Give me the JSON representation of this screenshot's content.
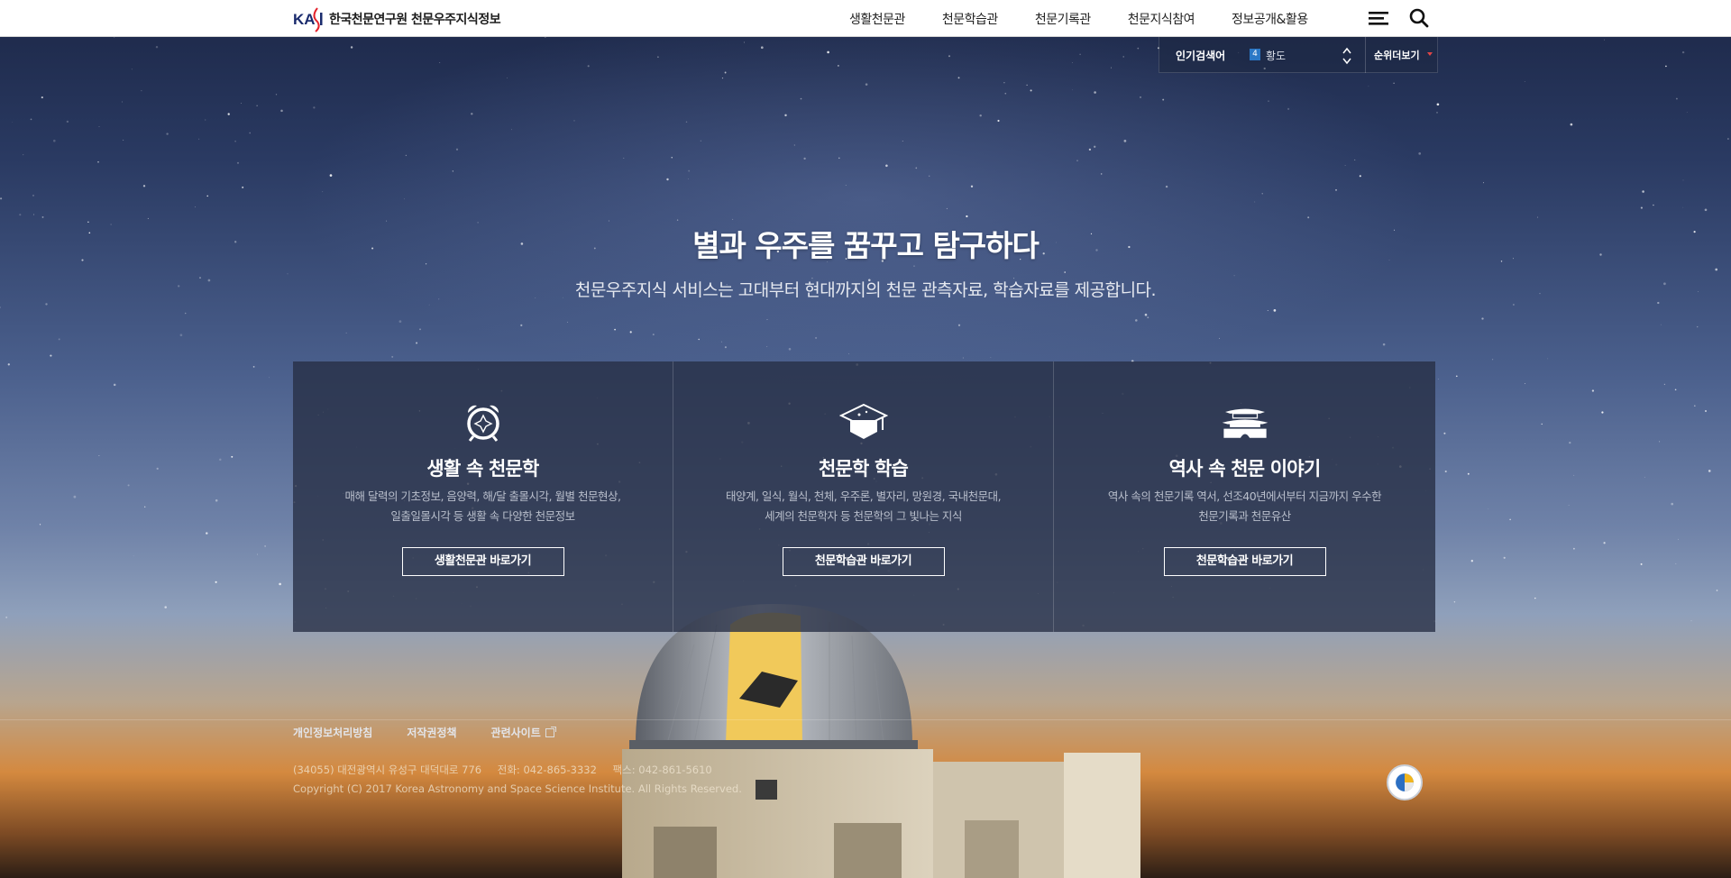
{
  "header": {
    "logo_mark": "KASI",
    "site_title": "한국천문연구원 천문우주지식정보",
    "nav": [
      "생활천문관",
      "천문학습관",
      "천문기록관",
      "천문지식참여",
      "정보공개&활용"
    ],
    "icons": {
      "menu": "hamburger-menu-icon",
      "search": "search-icon"
    }
  },
  "popular_search": {
    "label": "인기검색어",
    "rank": "4",
    "keyword": "황도",
    "more_label": "순위더보기"
  },
  "hero": {
    "title": "별과 우주를 꿈꾸고 탐구하다",
    "subtitle": "천문우주지식 서비스는 고대부터 현대까지의 천문 관측자료, 학습자료를 제공합니다."
  },
  "cards": [
    {
      "icon": "alarm-clock-icon",
      "title": "생활 속 천문학",
      "desc": [
        "매해 달력의 기초정보, 음양력, 해/달 출몰시각, 월별 천문현상,",
        "일출일몰시각 등 생활 속 다양한 천문정보"
      ],
      "button": "생활천문관 바로가기"
    },
    {
      "icon": "graduation-cap-icon",
      "title": "천문학 학습",
      "desc": [
        "태양계, 일식, 월식, 천체, 우주론, 별자리, 망원경, 국내천문대,",
        "세계의 천문학자 등 천문학의 그 빛나는 지식"
      ],
      "button": "천문학습관 바로가기"
    },
    {
      "icon": "palace-gate-icon",
      "title": "역사 속 천문 이야기",
      "desc": [
        "역사 속의 천문기록 역서, 선조40년에서부터 지금까지 우수한",
        "천문기록과 천문유산"
      ],
      "button": "천문학습관 바로가기"
    }
  ],
  "footer": {
    "links": [
      "개인정보처리방침",
      "저작권정책",
      "관련사이트"
    ],
    "address": "(34055) 대전광역시 유성구 대덕대로 776",
    "phone": "전화: 042-865-3332",
    "fax": "팩스: 042-861-5610",
    "copyright": "Copyright (C) 2017 Korea Astronomy and Space Science Institute. All Rights Reserved."
  }
}
